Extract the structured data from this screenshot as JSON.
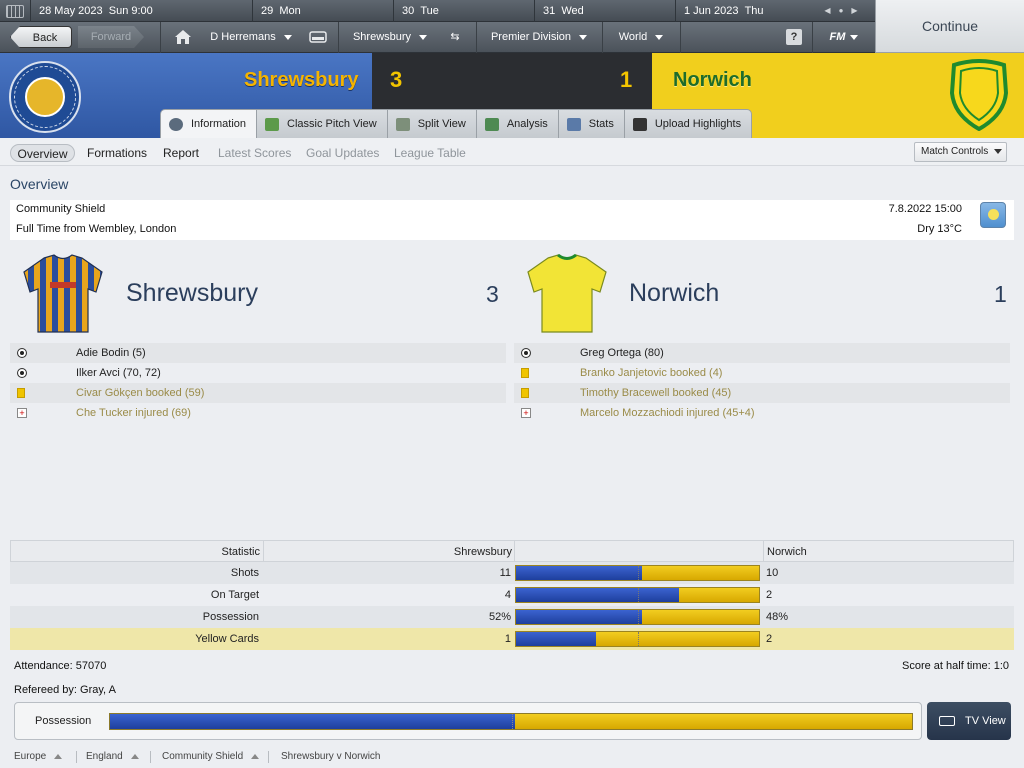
{
  "datebar": {
    "days": [
      {
        "date": "28 May 2023",
        "label": "Sun  9:00"
      },
      {
        "date": "29",
        "label": "Mon"
      },
      {
        "date": "30",
        "label": "Tue"
      },
      {
        "date": "31",
        "label": "Wed"
      },
      {
        "date": "1 Jun 2023",
        "label": "Thu"
      }
    ]
  },
  "nav": {
    "back": "Back",
    "forward": "Forward",
    "manager": "D Herremans",
    "club": "Shrewsbury",
    "league": "Premier Division",
    "world": "World",
    "help": "?",
    "fm": "FM",
    "continue": "Continue"
  },
  "match": {
    "home_name": "Shrewsbury",
    "home_score": "3",
    "away_score": "1",
    "away_name": "Norwich"
  },
  "tabs": [
    "Information",
    "Classic Pitch View",
    "Split View",
    "Analysis",
    "Stats",
    "Upload Highlights"
  ],
  "subtabs": {
    "overview": "Overview",
    "formations": "Formations",
    "report": "Report",
    "latest_scores": "Latest Scores",
    "goal_updates": "Goal Updates",
    "league_table": "League Table",
    "match_controls": "Match Controls"
  },
  "overview": {
    "title": "Overview",
    "competition": "Community Shield",
    "venue": "Full Time from Wembley, London",
    "datetime": "7.8.2022 15:00",
    "weather": "Dry 13°C",
    "home_events": [
      {
        "type": "goal",
        "text": "Adie Bodin (5)"
      },
      {
        "type": "goal",
        "text": "Ilker Avci (70, 72)"
      },
      {
        "type": "yellow",
        "text": "Civar Gökçen booked (59)"
      },
      {
        "type": "injury",
        "text": "Che Tucker injured (69)"
      }
    ],
    "away_events": [
      {
        "type": "goal",
        "text": "Greg Ortega (80)"
      },
      {
        "type": "yellow",
        "text": "Branko Janjetovic booked (4)"
      },
      {
        "type": "yellow",
        "text": "Timothy Bracewell booked (45)"
      },
      {
        "type": "injury",
        "text": "Marcelo Mozzachiodi injured (45+4)"
      }
    ]
  },
  "stats": {
    "header": {
      "stat": "Statistic",
      "home": "Shrewsbury",
      "away": "Norwich"
    },
    "rows": [
      {
        "label": "Shots",
        "home": "11",
        "away": "10",
        "home_share": 0.52
      },
      {
        "label": "On Target",
        "home": "4",
        "away": "2",
        "home_share": 0.67
      },
      {
        "label": "Possession",
        "home": "52%",
        "away": "48%",
        "home_share": 0.52
      },
      {
        "label": "Yellow Cards",
        "home": "1",
        "away": "2",
        "home_share": 0.33
      }
    ]
  },
  "footer": {
    "attendance": "Attendance: 57070",
    "halftime": "Score at half time: 1:0",
    "referee": "Refereed by: Gray, A",
    "possession_label": "Possession",
    "possession_home_share": 0.505,
    "tv_view": "TV View"
  },
  "breadcrumbs": [
    "Europe",
    "England",
    "Community Shield",
    "Shrewsbury v Norwich"
  ],
  "colors": {
    "home": "#2f57a3",
    "away": "#f1cf1d",
    "home_text": "#f5b400",
    "away_text": "#1e6c2a"
  }
}
